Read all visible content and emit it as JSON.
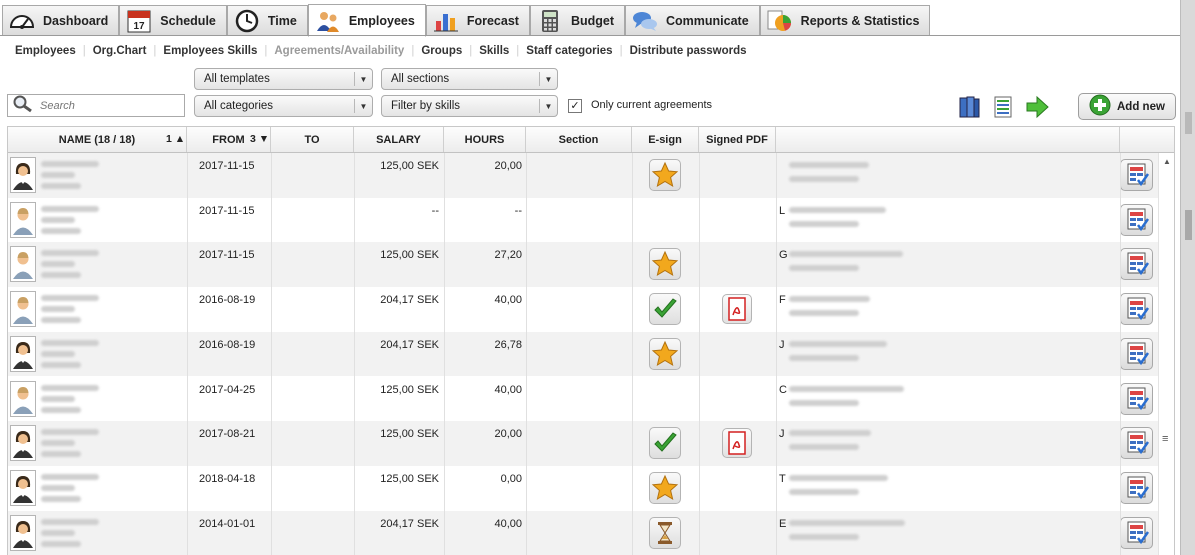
{
  "tabs": [
    {
      "label": "Dashboard",
      "icon": "speedometer-icon",
      "active": false
    },
    {
      "label": "Schedule",
      "icon": "calendar-icon",
      "active": false
    },
    {
      "label": "Time",
      "icon": "clock-icon",
      "active": false
    },
    {
      "label": "Employees",
      "icon": "people-icon",
      "active": true
    },
    {
      "label": "Forecast",
      "icon": "bar-chart-icon",
      "active": false
    },
    {
      "label": "Budget",
      "icon": "calculator-icon",
      "active": false
    },
    {
      "label": "Communicate",
      "icon": "speech-bubbles-icon",
      "active": false
    },
    {
      "label": "Reports & Statistics",
      "icon": "pie-chart-icon",
      "active": false
    }
  ],
  "calendar_day": "17",
  "subnav": [
    {
      "label": "Employees",
      "current": false
    },
    {
      "label": "Org.Chart",
      "current": false
    },
    {
      "label": "Employees Skills",
      "current": false
    },
    {
      "label": "Agreements/Availability",
      "current": true
    },
    {
      "label": "Groups",
      "current": false
    },
    {
      "label": "Skills",
      "current": false
    },
    {
      "label": "Staff categories",
      "current": false
    },
    {
      "label": "Distribute passwords",
      "current": false
    }
  ],
  "filters": {
    "templates": "All templates",
    "categories": "All categories",
    "sections": "All sections",
    "skills": "Filter by skills",
    "search_placeholder": "Search",
    "only_current_label": "Only current agreements",
    "only_current_checked": true,
    "add_new_label": "Add new"
  },
  "colors": {
    "accent_green": "#3aa335",
    "star": "#f2a81d",
    "pdf_red": "#d32020",
    "alt_row": "#f2f2f2"
  },
  "table": {
    "headers": {
      "name": "NAME (18 / 18)",
      "name_sort": "1 ▲",
      "from": "FROM",
      "from_sort": "3 ▼",
      "to": "TO",
      "salary": "SALARY",
      "hours": "HOURS",
      "section": "Section",
      "esign": "E-sign",
      "signed_pdf": "Signed PDF"
    },
    "rows": [
      {
        "avatar": "female",
        "from": "2017-11-15",
        "to": "",
        "salary": "125,00 SEK",
        "hours": "20,00",
        "esign": "star",
        "pdf": false,
        "agreement_initial": ""
      },
      {
        "avatar": "male",
        "from": "2017-11-15",
        "to": "",
        "salary": "--",
        "hours": "--",
        "esign": "",
        "pdf": false,
        "agreement_initial": "L"
      },
      {
        "avatar": "male",
        "from": "2017-11-15",
        "to": "",
        "salary": "125,00 SEK",
        "hours": "27,20",
        "esign": "star",
        "pdf": false,
        "agreement_initial": "G"
      },
      {
        "avatar": "male",
        "from": "2016-08-19",
        "to": "",
        "salary": "204,17 SEK",
        "hours": "40,00",
        "esign": "check",
        "pdf": true,
        "agreement_initial": "F"
      },
      {
        "avatar": "female",
        "from": "2016-08-19",
        "to": "",
        "salary": "204,17 SEK",
        "hours": "26,78",
        "esign": "star",
        "pdf": false,
        "agreement_initial": "J"
      },
      {
        "avatar": "male",
        "from": "2017-04-25",
        "to": "",
        "salary": "125,00 SEK",
        "hours": "40,00",
        "esign": "",
        "pdf": false,
        "agreement_initial": "C"
      },
      {
        "avatar": "female",
        "from": "2017-08-21",
        "to": "",
        "salary": "125,00 SEK",
        "hours": "20,00",
        "esign": "check",
        "pdf": true,
        "agreement_initial": "J"
      },
      {
        "avatar": "female",
        "from": "2018-04-18",
        "to": "",
        "salary": "125,00 SEK",
        "hours": "0,00",
        "esign": "star",
        "pdf": false,
        "agreement_initial": "T"
      },
      {
        "avatar": "female",
        "from": "2014-01-01",
        "to": "",
        "salary": "204,17 SEK",
        "hours": "40,00",
        "esign": "hourglass",
        "pdf": false,
        "agreement_initial": "E"
      }
    ]
  }
}
